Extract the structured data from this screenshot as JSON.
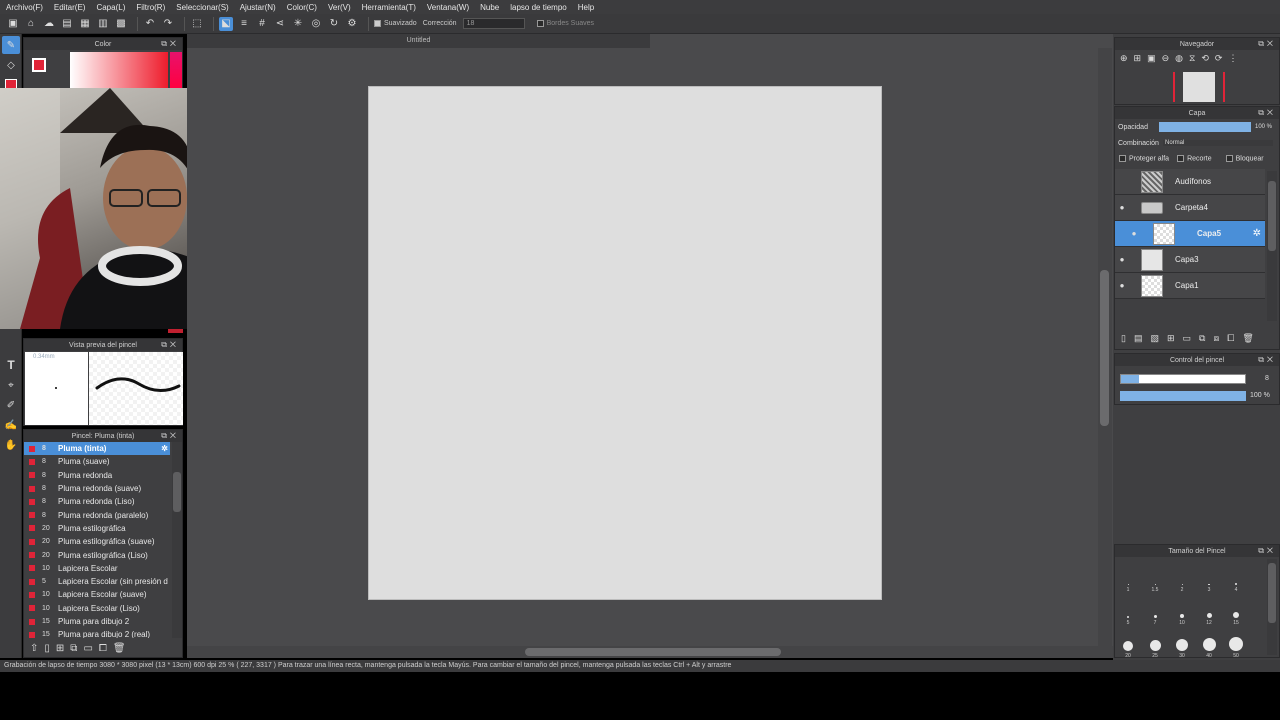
{
  "menu": [
    "Archivo(F)",
    "Editar(E)",
    "Capa(L)",
    "Filtro(R)",
    "Seleccionar(S)",
    "Ajustar(N)",
    "Color(C)",
    "Ver(V)",
    "Herramienta(T)",
    "Ventana(W)",
    "Nube",
    "lapso de tiempo",
    "Help"
  ],
  "toolbar": {
    "suavizado": "Suavizado",
    "correccion": "Corrección",
    "correccion_value": "18",
    "bordes": "Bordes Suaves"
  },
  "color_panel": {
    "title": "Color"
  },
  "doc": {
    "title": "Untitled"
  },
  "brush_preview": {
    "title": "Vista previa del pincel",
    "size": "0.34mm"
  },
  "brush_panel": {
    "title": "Pincel: Pluma (tinta)",
    "items": [
      {
        "size": "8",
        "name": "Pluma (tinta)"
      },
      {
        "size": "8",
        "name": "Pluma (suave)"
      },
      {
        "size": "8",
        "name": "Pluma redonda"
      },
      {
        "size": "8",
        "name": "Pluma redonda (suave)"
      },
      {
        "size": "8",
        "name": "Pluma redonda (Liso)"
      },
      {
        "size": "8",
        "name": "Pluma redonda (paralelo)"
      },
      {
        "size": "20",
        "name": "Pluma estilográfica"
      },
      {
        "size": "20",
        "name": "Pluma estilográfica (suave)"
      },
      {
        "size": "20",
        "name": "Pluma estilográfica (Liso)"
      },
      {
        "size": "10",
        "name": "Lapicera Escolar"
      },
      {
        "size": "5",
        "name": "Lapicera Escolar (sin presión d"
      },
      {
        "size": "10",
        "name": "Lapicera Escolar (suave)"
      },
      {
        "size": "10",
        "name": "Lapicera Escolar (Liso)"
      },
      {
        "size": "15",
        "name": "Pluma para dibujo 2"
      },
      {
        "size": "15",
        "name": "Pluma para dibujo 2 (real)"
      }
    ]
  },
  "navigator": {
    "title": "Navegador"
  },
  "layer_panel": {
    "title": "Capa",
    "opacity_label": "Opacidad",
    "opacity_value": "100 %",
    "blend_label": "Combinación",
    "blend_value": "Normal",
    "protect_alpha": "Proteger alfa",
    "clip": "Recorte",
    "lock": "Bloquear",
    "layers": [
      {
        "name": "Audífonos",
        "eye": ""
      },
      {
        "name": "Carpeta4",
        "eye": "●"
      },
      {
        "name": "Capa5",
        "eye": "●"
      },
      {
        "name": "Capa3",
        "eye": "●"
      },
      {
        "name": "Capa1",
        "eye": "●"
      }
    ]
  },
  "brush_control": {
    "title": "Control del pincel",
    "size_value": "8",
    "opacity_value": "100 %"
  },
  "brush_size": {
    "title": "Tamaño del Pincel",
    "labels": [
      "1",
      "1.5",
      "2",
      "3",
      "4",
      "5",
      "7",
      "10",
      "12",
      "15",
      "20",
      "25",
      "30",
      "40",
      "50"
    ]
  },
  "status": "Grabación de lapso de tiempo   3080 * 3080 pixel  (13 * 13cm)  600 dpi  25 %  ( 227, 3317 )  Para trazar una línea recta, mantenga pulsada la tecla Mayús. Para cambiar el tamaño del pincel, mantenga pulsada las teclas Ctrl + Alt y arrastre"
}
